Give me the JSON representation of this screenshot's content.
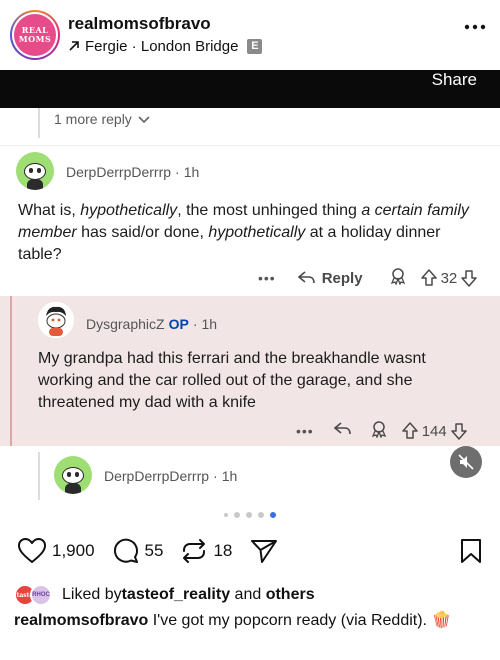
{
  "header": {
    "avatar_text_line1": "REAL",
    "avatar_text_line2": "MOMS",
    "username": "realmomsofbravo",
    "audio_icon": "arrow-up-right-icon",
    "audio_text": "Fergie · London Bridge",
    "explicit_badge": "E",
    "more_icon": "more-dots-icon"
  },
  "screenshot": {
    "share_label": "Share",
    "more_replies": "1 more reply",
    "comment1": {
      "author": "DerpDerrpDerrrp",
      "age": "1h",
      "body_parts": [
        "What is, ",
        "hypothetically",
        ", the most unhinged thing ",
        "a certain family member",
        " has said/or done, ",
        "hypothetically",
        " at a holiday dinner table?"
      ],
      "reply_label": "Reply",
      "votes": "32"
    },
    "comment2": {
      "author": "DysgraphicZ",
      "op_label": "OP",
      "age": "1h",
      "body": "My grandpa had this ferrari and the breakhandle wasnt working and the car rolled out of the garage, and she threatened my dad with a knife",
      "votes": "144"
    },
    "comment3": {
      "author": "DerpDerrpDerrrp",
      "age": "1h"
    }
  },
  "post": {
    "likes": "1,900",
    "comments": "55",
    "reposts": "18",
    "liked_avatar1_text": "tasto",
    "liked_avatar2_text": "RHOC",
    "liked_prefix": "Liked by ",
    "liked_user": "tasteof_reality",
    "liked_and": " and ",
    "liked_others": "others",
    "caption_user": "realmomsofbravo",
    "caption_text": " I've got my popcorn ready (via Reddit). 🍿"
  },
  "colors": {
    "op": "#0045ac",
    "highlight_bg": "#f1e6e5",
    "snoo_green": "#9ede73",
    "carousel_active": "#3c6fe2"
  }
}
